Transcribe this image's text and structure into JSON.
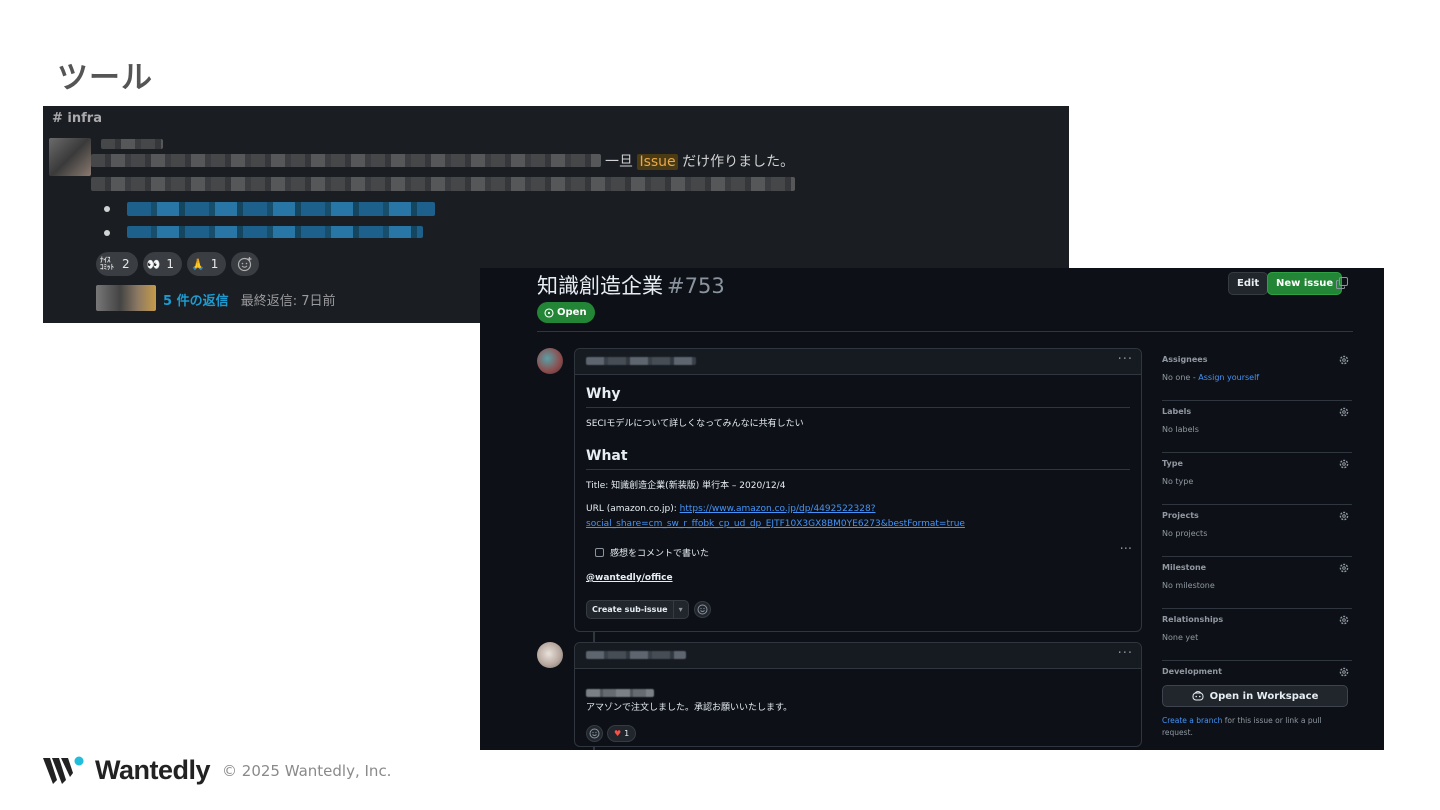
{
  "slide": {
    "title": "ツール"
  },
  "slack": {
    "channel": "# infra",
    "message_tail_before": "一旦 ",
    "message_highlight": "Issue",
    "message_tail_after": " だけ作りました。",
    "reactions": [
      {
        "emoji": "ﾅｲｽ ｺﾐｯﾄ",
        "count": "2"
      },
      {
        "emoji": "👀",
        "count": "1"
      },
      {
        "emoji": "🙏",
        "count": "1"
      }
    ],
    "add_reaction_icon": "add-reaction-icon",
    "replies_count": "5 件の返信",
    "last_reply": "最終返信: 7日前"
  },
  "github": {
    "title": "知識創造企業",
    "number": "#753",
    "status": "Open",
    "edit_label": "Edit",
    "new_issue_label": "New issue",
    "comment1": {
      "h_why": "Why",
      "why_text": "SECIモデルについて詳しくなってみんなに共有したい",
      "h_what": "What",
      "title_line": "Title: 知識創造企業(新装版) 単行本 – 2020/12/4",
      "url_prefix": "URL (amazon.co.jp): ",
      "url_part1": "https://www.amazon.co.jp/dp/4492522328?",
      "url_part2": "social_share=cm_sw_r_ffobk_cp_ud_dp_EJTF10X3GX8BM0YE6273&bestFormat=true",
      "checkbox_label": "感想をコメントで書いた",
      "mention": "@wantedly/office",
      "sub_issue_label": "Create sub-issue"
    },
    "comment2": {
      "text": "アマゾンで注文しました。承認お願いいたします。",
      "heart_count": "1"
    },
    "sidebar": {
      "assignees_title": "Assignees",
      "assignees_value": "No one - ",
      "assign_yourself": "Assign yourself",
      "labels_title": "Labels",
      "labels_value": "No labels",
      "type_title": "Type",
      "type_value": "No type",
      "projects_title": "Projects",
      "projects_value": "No projects",
      "milestone_title": "Milestone",
      "milestone_value": "No milestone",
      "relationships_title": "Relationships",
      "relationships_value": "None yet",
      "development_title": "Development",
      "workspace_label": "Open in Workspace",
      "create_branch": "Create a branch",
      "dev_note": " for this issue or link a pull request."
    }
  },
  "footer": {
    "brand": "Wantedly",
    "copyright": "© 2025 Wantedly, Inc."
  }
}
